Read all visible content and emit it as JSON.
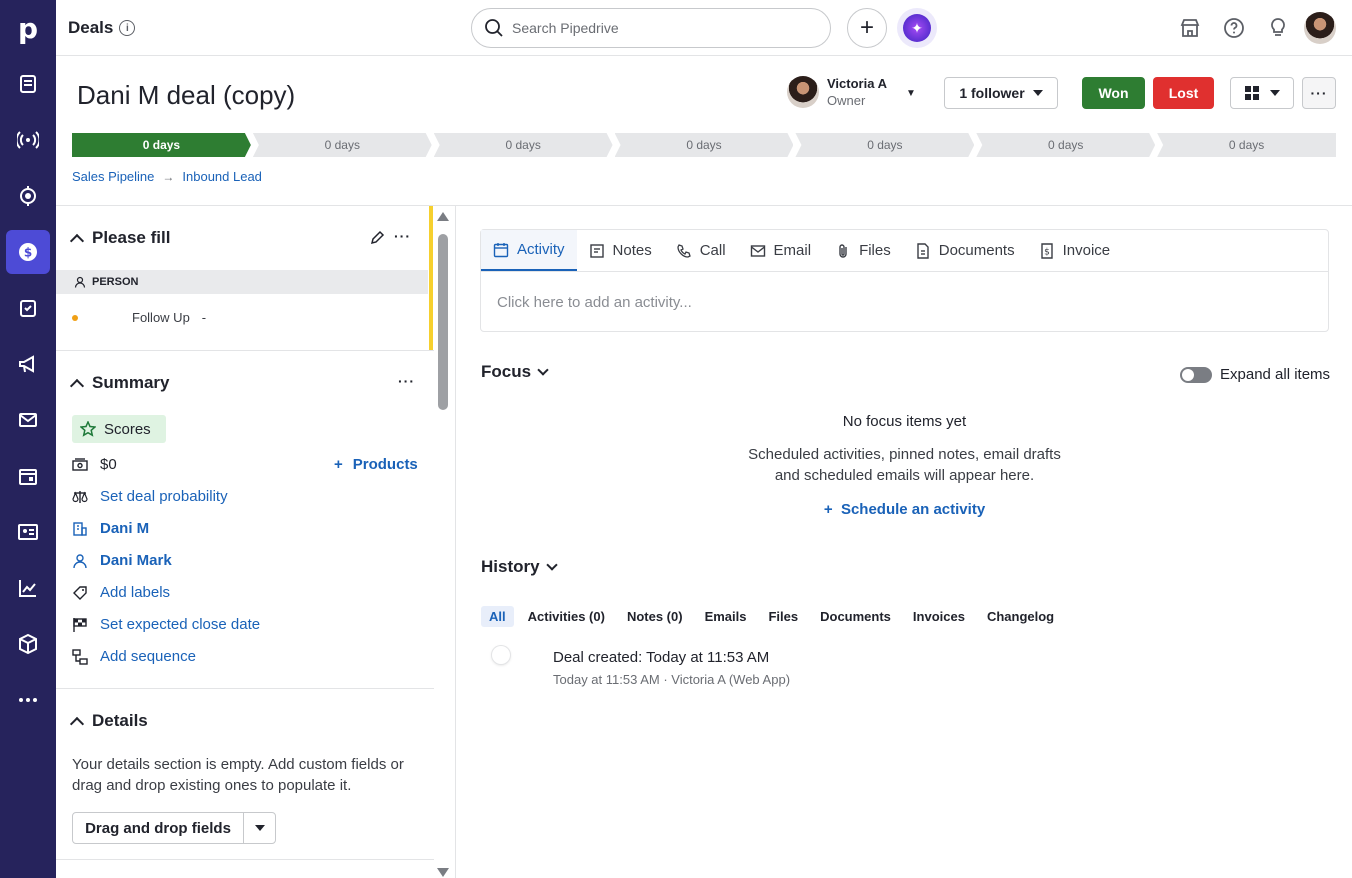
{
  "rail": {
    "logo": "p",
    "items": [
      "leads-icon",
      "signal-icon",
      "target-icon",
      "deals-icon",
      "tasks-icon",
      "campaigns-icon",
      "mail-icon",
      "calendar-icon",
      "contacts-icon",
      "insights-icon",
      "products-icon",
      "more-icon"
    ],
    "active": "deals-icon"
  },
  "topbar": {
    "title": "Deals",
    "search_placeholder": "Search Pipedrive"
  },
  "deal": {
    "title": "Dani M deal (copy)",
    "owner_name": "Victoria A",
    "owner_role": "Owner",
    "follower_label": "1 follower",
    "won_label": "Won",
    "lost_label": "Lost",
    "stages": [
      "0 days",
      "0 days",
      "0 days",
      "0 days",
      "0 days",
      "0 days",
      "0 days"
    ],
    "breadcrumb": [
      "Sales Pipeline",
      "Inbound Lead"
    ]
  },
  "left": {
    "please_fill_title": "Please fill",
    "person_label": "PERSON",
    "followup_label": "Follow Up",
    "followup_value": "-",
    "summary_title": "Summary",
    "scores_label": "Scores",
    "value": "$0",
    "products_label": "Products",
    "probability_label": "Set deal probability",
    "org_name": "Dani M",
    "person_name": "Dani Mark",
    "labels_label": "Add labels",
    "close_date_label": "Set expected close date",
    "sequence_label": "Add sequence",
    "details_title": "Details",
    "details_text": "Your details section is empty. Add custom fields or drag and drop existing ones to populate it.",
    "dnd_label": "Drag and drop fields"
  },
  "main": {
    "tabs": [
      "Activity",
      "Notes",
      "Call",
      "Email",
      "Files",
      "Documents",
      "Invoice"
    ],
    "activity_placeholder": "Click here to add an activity...",
    "focus_title": "Focus",
    "expand_label": "Expand all items",
    "empty_title": "No focus items yet",
    "empty_desc_1": "Scheduled activities, pinned notes, email drafts",
    "empty_desc_2": "and scheduled emails will appear here.",
    "schedule_label": "Schedule an activity",
    "history_title": "History",
    "history_tabs": [
      "All",
      "Activities (0)",
      "Notes (0)",
      "Emails",
      "Files",
      "Documents",
      "Invoices",
      "Changelog"
    ],
    "history_event": "Deal created",
    "history_event_time": "Today at 11:53 AM",
    "history_meta": "Today at 11:53 AM · Victoria A (Web App)"
  },
  "colors": {
    "rail": "#26235c",
    "rail_active": "#4d4bd6",
    "won": "#2e7d32",
    "lost": "#e0302f",
    "link": "#1a62b8"
  }
}
